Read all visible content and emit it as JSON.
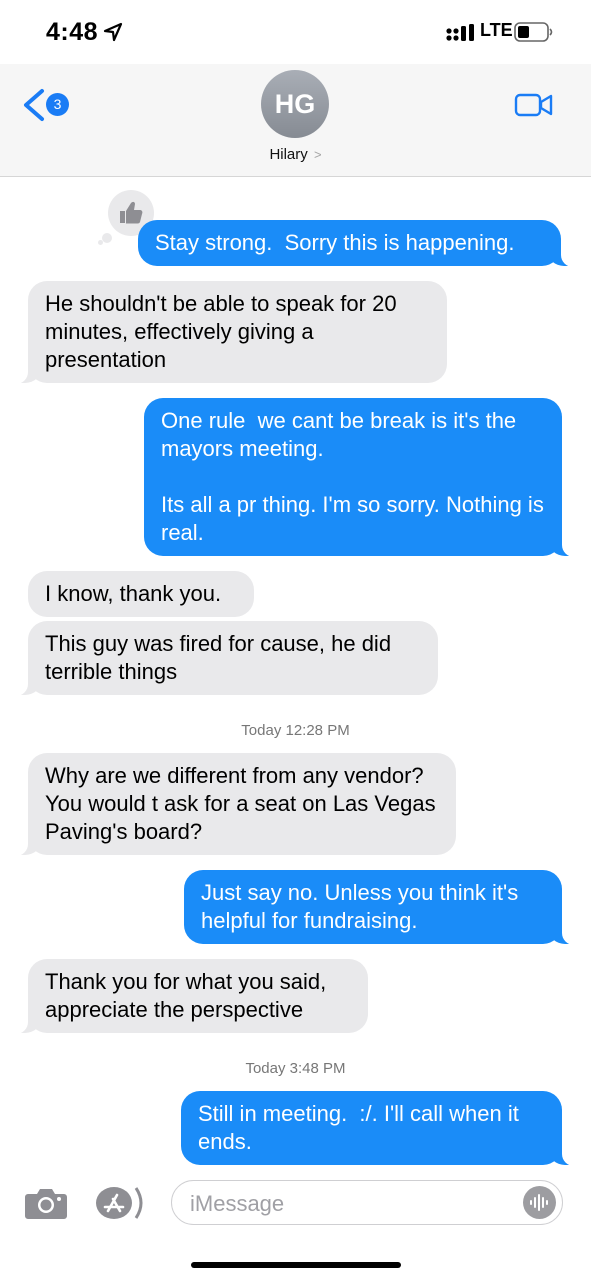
{
  "status_bar": {
    "time": "4:48",
    "network": "LTE"
  },
  "header": {
    "unread_count": "3",
    "avatar_initials": "HG",
    "contact_name": "Hilary",
    "contact_chevron": ">"
  },
  "messages": [
    {
      "side": "out",
      "text": "Stay strong.  Sorry this is happening.",
      "reaction": "thumbs-up"
    },
    {
      "side": "in",
      "text": "He shouldn't be able to speak for 20 minutes, effectively giving a presentation"
    },
    {
      "side": "out",
      "text": "One rule  we cant be break is it's the mayors meeting.\n\nIts all a pr thing. I'm so sorry. Nothing is real."
    },
    {
      "side": "in",
      "text": "I know, thank you."
    },
    {
      "side": "in",
      "text": "This guy was fired for cause, he did terrible things"
    },
    {
      "side": "in",
      "text": "Why are we different from any vendor? You would t ask for a seat on Las Vegas Paving's board?"
    },
    {
      "side": "out",
      "text": "Just say no. Unless you think it's helpful for fundraising."
    },
    {
      "side": "in",
      "text": "Thank you for what you said, appreciate the perspective"
    },
    {
      "side": "out",
      "text": "Still in meeting.  :/. I'll call when it ends."
    }
  ],
  "timestamps": [
    "Today 12:28 PM",
    "Today 3:48 PM"
  ],
  "compose": {
    "placeholder": "iMessage"
  },
  "colors": {
    "outgoing": "#1a8cf8",
    "incoming": "#e9e9eb",
    "accent": "#1a7cf5"
  }
}
